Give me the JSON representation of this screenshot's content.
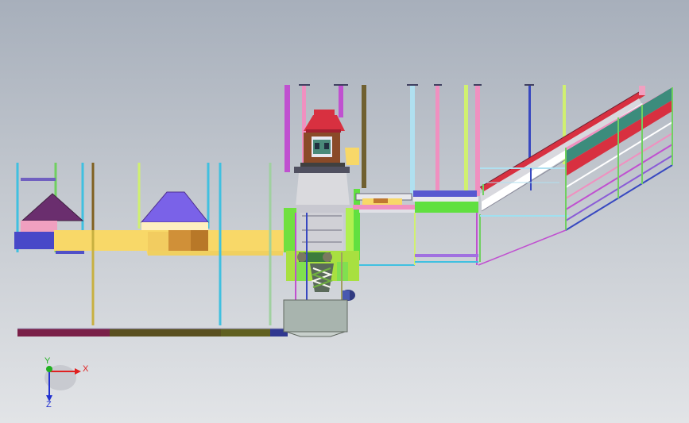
{
  "viewport": {
    "background_top": "#a7afbb",
    "background_bottom": "#e2e4e7"
  },
  "triad": {
    "x_label": "X",
    "y_label": "Y",
    "z_label": "Z",
    "x_color": "#e02020",
    "y_color": "#20b020",
    "z_color": "#2030d0"
  },
  "colors": {
    "magenta": "#c050d0",
    "pink": "#f090c0",
    "yellow": "#f8d868",
    "teal": "#3c8c7c",
    "red": "#f03848",
    "green": "#60e040",
    "lime": "#a8e040",
    "blue": "#3848c0",
    "purple": "#8a5cd6",
    "roof": "#d83040",
    "brown": "#8a4a28"
  }
}
